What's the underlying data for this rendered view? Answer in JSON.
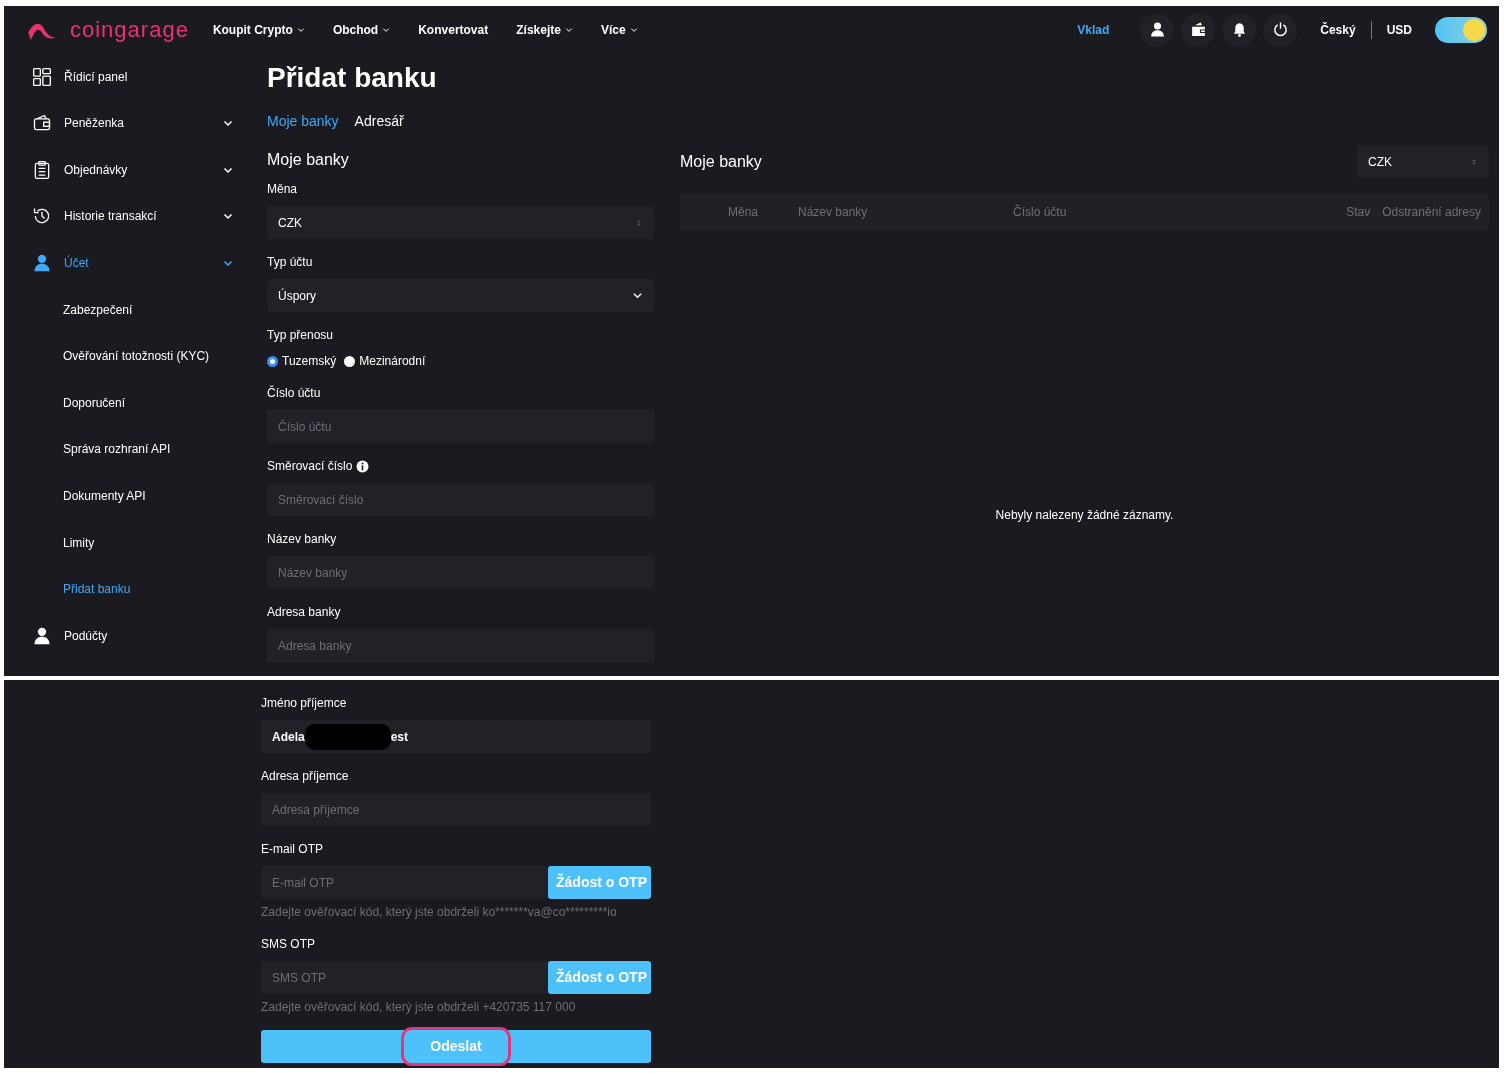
{
  "brand": {
    "name": "coingarage"
  },
  "nav": [
    {
      "label": "Koupit Crypto",
      "dropdown": true
    },
    {
      "label": "Obchod",
      "dropdown": true
    },
    {
      "label": "Konvertovat",
      "dropdown": false
    },
    {
      "label": "Získejte",
      "dropdown": true
    },
    {
      "label": "Více",
      "dropdown": true
    }
  ],
  "header_right": {
    "deposit": "Vklad",
    "language": "Český",
    "currency": "USD",
    "theme_toggle_on": true
  },
  "sidebar": {
    "items": [
      {
        "label": "Řídicí panel",
        "has_chevron": false,
        "selected": false
      },
      {
        "label": "Peněženka",
        "has_chevron": true,
        "selected": false
      },
      {
        "label": "Objednávky",
        "has_chevron": true,
        "selected": false
      },
      {
        "label": "Historie transakcí",
        "has_chevron": true,
        "selected": false
      },
      {
        "label": "Účet",
        "has_chevron": true,
        "selected": true,
        "children": [
          {
            "label": "Zabezpečení",
            "selected": false
          },
          {
            "label": "Ověřování totožnosti (KYC)",
            "selected": false
          },
          {
            "label": "Doporučení",
            "selected": false
          },
          {
            "label": "Správa rozhraní API",
            "selected": false
          },
          {
            "label": "Dokumenty API",
            "selected": false
          },
          {
            "label": "Limity",
            "selected": false
          },
          {
            "label": "Přidat banku",
            "selected": true
          }
        ]
      },
      {
        "label": "Podúčty",
        "has_chevron": false,
        "selected": false
      }
    ]
  },
  "page_title": "Přidat banku",
  "subtabs": [
    {
      "label": "Moje banky",
      "selected": true
    },
    {
      "label": "Adresář",
      "selected": false
    }
  ],
  "form": {
    "title": "Moje banky",
    "fields": [
      {
        "kind": "sortselect",
        "label": "Měna",
        "value": "CZK"
      },
      {
        "kind": "dropdown",
        "label": "Typ účtu",
        "value": "Úspory"
      },
      {
        "kind": "radio",
        "label": "Typ přenosu",
        "options": [
          {
            "label": "Tuzemský",
            "selected": true
          },
          {
            "label": "Mezinárodní",
            "selected": false
          }
        ]
      },
      {
        "kind": "input",
        "label": "Číslo účtu",
        "placeholder": "Číslo účtu"
      },
      {
        "kind": "input",
        "label": "Směrovací číslo",
        "placeholder": "Směrovací číslo",
        "info": true
      },
      {
        "kind": "input",
        "label": "Název banky",
        "placeholder": "Název banky"
      },
      {
        "kind": "input",
        "label": "Adresa banky",
        "placeholder": "Adresa banky"
      }
    ],
    "continued": [
      {
        "kind": "redacted",
        "label": "Jméno příjemce",
        "value_before": "Adela",
        "value_after": "est"
      },
      {
        "kind": "input",
        "label": "Adresa příjemce",
        "placeholder": "Adresa příjemce"
      },
      {
        "kind": "otp",
        "label": "E-mail OTP",
        "placeholder": "E-mail OTP",
        "button": "Žádost o OTP",
        "hint": "Zadejte ověřovací kód, který jste obdrželi ko*******va@co*********io"
      },
      {
        "kind": "otp",
        "label": "SMS OTP",
        "placeholder": "SMS OTP",
        "button": "Žádost o OTP",
        "hint": "Zadejte ověřovací kód, který jste obdrželi +420735 117 000"
      }
    ],
    "submit": {
      "label": "Odeslat",
      "highlighted": true
    }
  },
  "list": {
    "title": "Moje banky",
    "currency": "CZK",
    "table": {
      "columns": [
        "Měna",
        "Název banky",
        "Číslo účtu",
        "Stav",
        "Odstranění adresy"
      ],
      "empty": "Nebyly nalezeny žádné záznamy."
    }
  }
}
